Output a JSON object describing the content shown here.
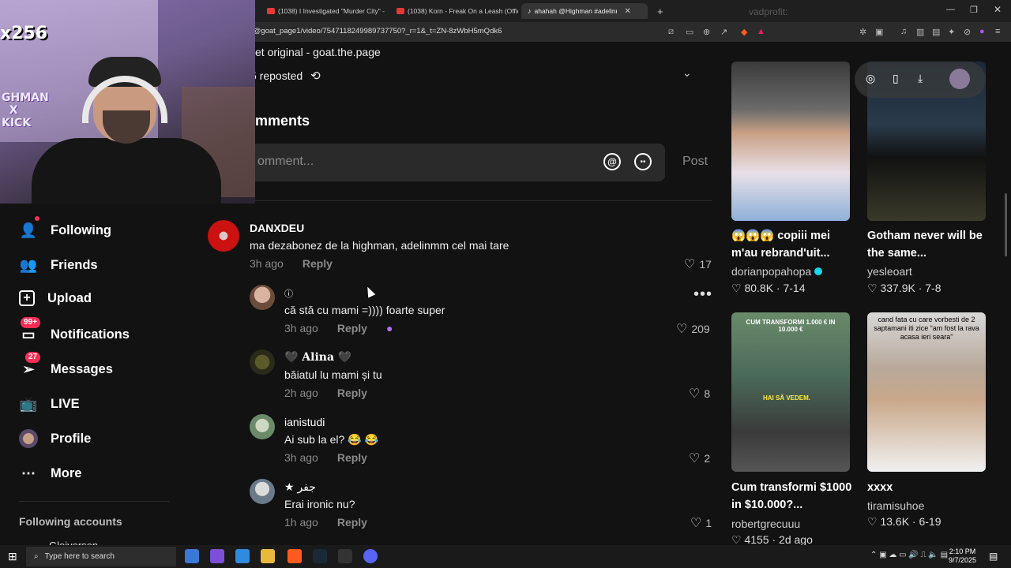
{
  "browser": {
    "tabs": [
      {
        "label": "(1038) I Investigated \"Murder City\" -"
      },
      {
        "label": "(1038) Korn - Freak On a Leash (Offic"
      },
      {
        "label": "ahahah @Highman #adelinmm"
      }
    ],
    "url": "/@goat_page1/video/7547118249989737750?_r=1&_t=ZN-8zWbH5mQdk6",
    "chat_user": "vadprofit:"
  },
  "webcam": {
    "count_overlay": "x256",
    "brand_overlay": "GHMAN\n  X\nKICK"
  },
  "video_info": {
    "sound": "et original - goat.the.page",
    "reposted": "5 reposted"
  },
  "comments_section": {
    "title": "mments",
    "input_placeholder": "omment...",
    "post_label": "Post"
  },
  "comments": [
    {
      "name": "DANXDEU",
      "text": "ma dezabonez de la highman, adelinmm cel mai tare",
      "time": "3h ago",
      "reply": "Reply",
      "likes": "17"
    },
    {
      "name": "ⓘ",
      "text": "că stă cu mami =)))) foarte super",
      "time": "3h ago",
      "reply": "Reply",
      "likes": "209"
    },
    {
      "name": "🖤 Alina 🖤",
      "text": "băiatul lu mami și tu",
      "time": "2h ago",
      "reply": "Reply",
      "likes": "8"
    },
    {
      "name": "ianistudi",
      "text": "Ai sub la el? 😂 😂",
      "time": "3h ago",
      "reply": "Reply",
      "likes": "2"
    },
    {
      "name": "★ جفر",
      "text": "Erai ironic nu?",
      "time": "1h ago",
      "reply": "Reply",
      "likes": "1"
    }
  ],
  "sidebar": {
    "items": [
      {
        "label": "Following",
        "icon": "following-icon"
      },
      {
        "label": "Friends",
        "icon": "friends-icon"
      },
      {
        "label": "Upload",
        "icon": "upload-icon"
      },
      {
        "label": "Notifications",
        "icon": "notifications-icon",
        "badge": "99+"
      },
      {
        "label": "Messages",
        "icon": "messages-icon",
        "badge": "27"
      },
      {
        "label": "LIVE",
        "icon": "live-icon"
      },
      {
        "label": "Profile",
        "icon": "avatar"
      },
      {
        "label": "More",
        "icon": "more-icon"
      }
    ],
    "following_accounts_title": "Following accounts",
    "first_account": "Gleiverson"
  },
  "related_videos": [
    {
      "title": "😱😱😱 copiii mei m'au rebrand'uit...",
      "author": "dorianpopahopa",
      "verified": true,
      "stats": "80.8K · 7-14"
    },
    {
      "title": "Gotham never will be the same...",
      "author": "yesleoart",
      "verified": false,
      "stats": "337.9K · 7-8"
    },
    {
      "title": "Cum transformi $1000 in $10.000?...",
      "author": "robertgrecuuu",
      "verified": false,
      "stats": "4155 · 2d ago",
      "thumb_text_top": "CUM TRANSFORMI 1.000 € IN 10.000 €",
      "thumb_text_mid": "HAI SĂ VEDEM."
    },
    {
      "title": "xxxx",
      "author": "tiramisuhoe",
      "verified": false,
      "stats": "13.6K · 6-19",
      "thumb_text_top": "cand fata cu care vorbesti de 2 saptamani iti zice “am fost la rava acasa ieri seara”"
    }
  ],
  "taskbar": {
    "search_placeholder": "Type here to search",
    "time": "2:10 PM",
    "date": "9/7/2025"
  },
  "colors": {
    "accent": "#fe2c55",
    "background": "#121212"
  }
}
